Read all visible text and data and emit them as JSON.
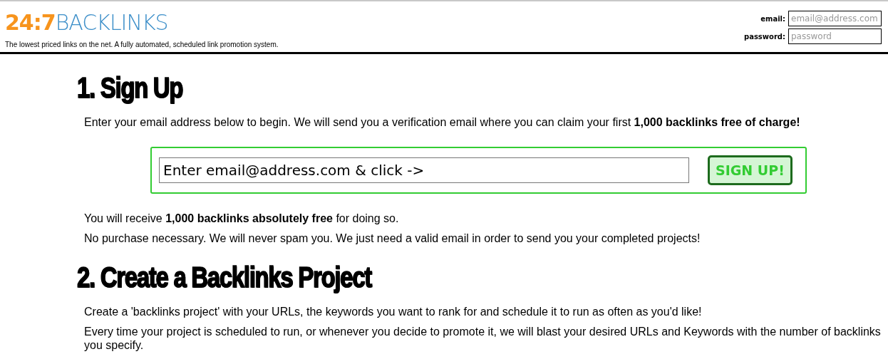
{
  "header": {
    "logo": {
      "digits": "24:7",
      "word": "BACKLINKS"
    },
    "tagline": "The lowest priced links on the net. A fully automated, scheduled link promotion system.",
    "login": [
      {
        "label": "email:",
        "placeholder": "email@address.com"
      },
      {
        "label": "password:",
        "placeholder": "password"
      }
    ]
  },
  "sections": [
    {
      "heading": "1. Sign Up",
      "paragraphs_before": [
        "Enter your email address below to begin. We will send you a verification email where you can claim your first **1,000 backlinks free of charge!**"
      ],
      "signup": {
        "value": "Enter email@address.com & click ->",
        "button": "SIGN UP!"
      },
      "paragraphs_after": [
        "You will receive **1,000 backlinks absolutely free** for doing so.",
        "No purchase necessary. We will never spam you. We just need a valid email in order to send you your completed projects!"
      ]
    },
    {
      "heading": "2. Create a Backlinks Project",
      "paragraphs_before": [
        "Create a 'backlinks project' with your URLs, the keywords you want to rank for and schedule it to run as often as you'd like!",
        "Every time your project is scheduled to run, or whenever you decide to promote it, we will blast your desired URLs and Keywords with the number of backlinks you specify."
      ]
    }
  ]
}
